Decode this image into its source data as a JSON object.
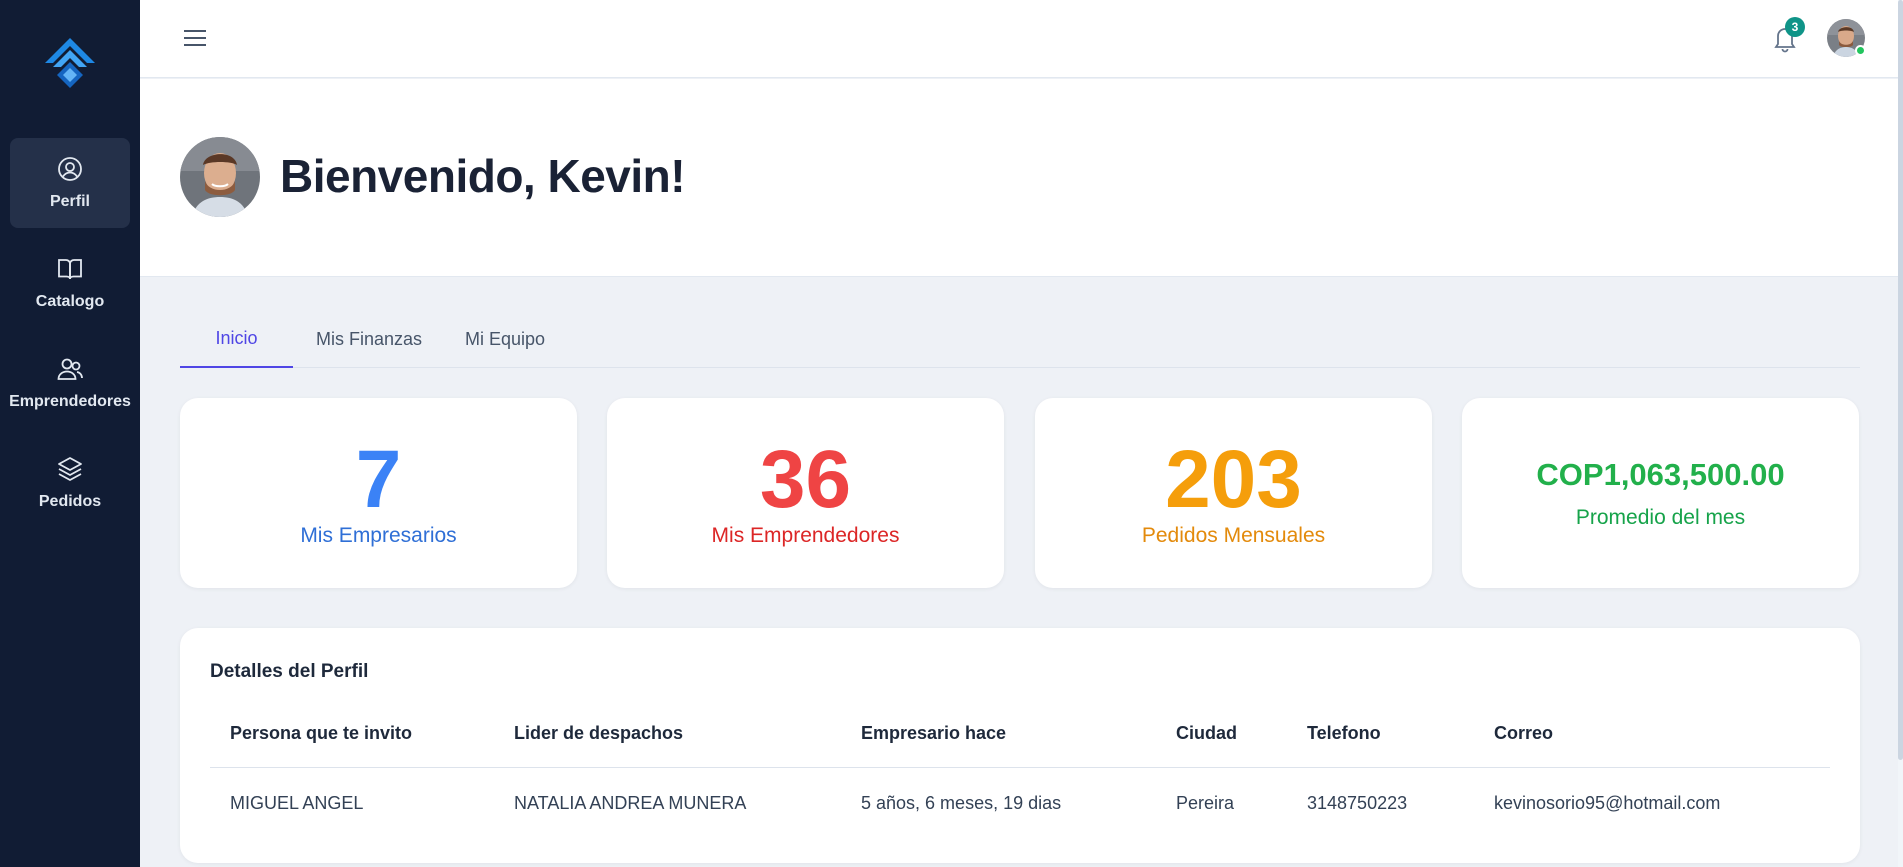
{
  "sidebar": {
    "items": [
      {
        "label": "Perfil",
        "icon": "user-circle-icon",
        "active": true
      },
      {
        "label": "Catalogo",
        "icon": "book-open-icon",
        "active": false
      },
      {
        "label": "Emprendedores",
        "icon": "users-icon",
        "active": false
      },
      {
        "label": "Pedidos",
        "icon": "layers-icon",
        "active": false
      }
    ]
  },
  "topbar": {
    "notification_count": "3"
  },
  "welcome": {
    "title": "Bienvenido, Kevin!"
  },
  "tabs": [
    {
      "label": "Inicio",
      "active": true
    },
    {
      "label": "Mis Finanzas",
      "active": false
    },
    {
      "label": "Mi Equipo",
      "active": false
    }
  ],
  "stats": [
    {
      "value": "7",
      "label": "Mis Empresarios",
      "color": "#3b82f6",
      "label_color": "#2f6fd6"
    },
    {
      "value": "36",
      "label": "Mis Emprendedores",
      "color": "#ef4444",
      "label_color": "#dc2626"
    },
    {
      "value": "203",
      "label": "Pedidos Mensuales",
      "color": "#f59e0b",
      "label_color": "#e38a0b"
    },
    {
      "value": "COP1,063,500.00",
      "label": "Promedio del mes",
      "color": "#22b04b",
      "label_color": "#16a34a"
    }
  ],
  "details": {
    "title": "Detalles del Perfil",
    "columns": [
      "Persona que te invito",
      "Lider de despachos",
      "Empresario hace",
      "Ciudad",
      "Telefono",
      "Correo"
    ],
    "rows": [
      [
        "MIGUEL ANGEL",
        "NATALIA ANDREA MUNERA",
        "5 años, 6 meses, 19 dias",
        "Pereira",
        "3148750223",
        "kevinosorio95@hotmail.com"
      ]
    ]
  },
  "colors": {
    "sidebar_bg": "#111c34",
    "accent": "#4f46e5",
    "badge": "#0f9488",
    "online": "#22c55e"
  }
}
